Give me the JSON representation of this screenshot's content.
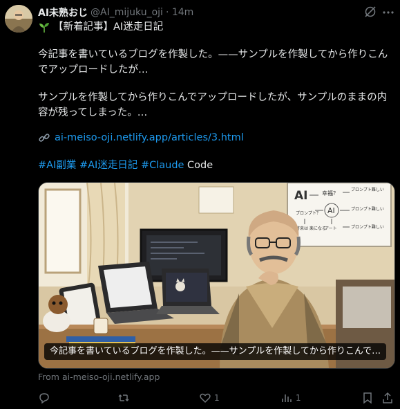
{
  "author": {
    "name": "AI未熟おじ",
    "handle": "@AI_mijuku_oji",
    "time": "· 14m"
  },
  "post": {
    "title": "【新着記事】AI迷走日記",
    "para1": "今記事を書いているブログを作製した。——サンプルを作製してから作りこんでアップロードしたが…",
    "para2": "サンプルを作製してから作りこんでアップロードしたが、サンプルのままの内容が残ってしまった。…",
    "link": "ai-meiso-oji.netlify.app/articles/3.html",
    "tags": [
      "#AI副業",
      "#AI迷走日記",
      "#Claude"
    ],
    "tags_suffix": " Code"
  },
  "card": {
    "caption": "今記事を書いているブログを作製した。——サンプルを作製してから作りこんで…",
    "whiteboard": {
      "ai": "AI",
      "q1": "幸福？",
      "t1": "プロンプト難しい",
      "t2": "プロンプト？",
      "t3": "プロンプト難しい",
      "t4": "アート",
      "t5": "プロンプト難しい",
      "t6": "AI",
      "t7": "将来は\n楽になる"
    }
  },
  "from": "From ai-meiso-oji.netlify.app",
  "actions": {
    "reply_count": "",
    "repost_count": "",
    "like_count": "1",
    "views_count": "1"
  },
  "colors": {
    "background": "#000000",
    "text": "#e7e9ea",
    "muted": "#71767b",
    "link": "#1d9bf0"
  },
  "icons": [
    "grok-icon",
    "more-icon",
    "sprout-icon",
    "link-icon",
    "reply-icon",
    "repost-icon",
    "like-icon",
    "views-icon",
    "bookmark-icon",
    "share-icon"
  ]
}
